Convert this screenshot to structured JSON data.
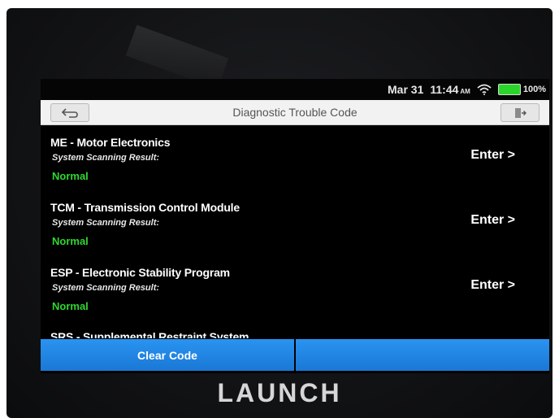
{
  "status_bar": {
    "date": "Mar 31",
    "time": "11:44",
    "ampm": "AM",
    "battery_percent": "100%"
  },
  "title_bar": {
    "title": "Diagnostic Trouble Code"
  },
  "systems": [
    {
      "name": "ME - Motor Electronics",
      "sub_label": "System Scanning Result:",
      "status": "Normal",
      "action": "Enter >"
    },
    {
      "name": "TCM - Transmission Control Module",
      "sub_label": "System Scanning Result:",
      "status": "Normal",
      "action": "Enter >"
    },
    {
      "name": "ESP - Electronic Stability Program",
      "sub_label": "System Scanning Result:",
      "status": "Normal",
      "action": "Enter >"
    },
    {
      "name": "SRS - Supplemental Restraint System"
    }
  ],
  "bottom_bar": {
    "clear_code": "Clear Code",
    "second_button": ""
  },
  "device": {
    "brand": "LAUNCH"
  },
  "colors": {
    "accent_blue": "#1f86e4",
    "status_green": "#2ed82e",
    "battery_green": "#2bd62b"
  }
}
